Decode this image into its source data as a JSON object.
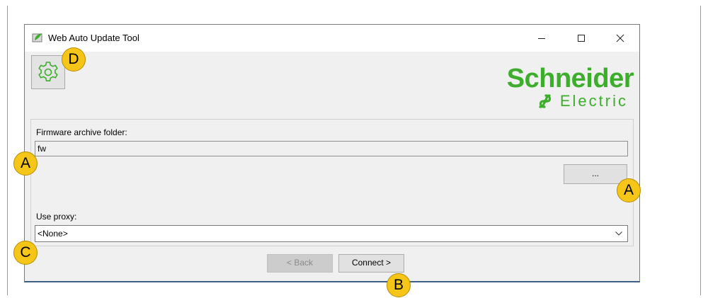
{
  "window": {
    "title": "Web Auto Update Tool",
    "minimize_icon": "minimize-icon",
    "maximize_icon": "maximize-icon",
    "close_icon": "close-icon"
  },
  "toolbar": {
    "settings_icon": "gear-icon"
  },
  "logo": {
    "line1": "Schneider",
    "line2": "Electric",
    "color": "#3dae2b"
  },
  "firmware": {
    "label": "Firmware archive folder:",
    "value": "fw",
    "browse_label": "..."
  },
  "proxy": {
    "label": "Use proxy:",
    "selected": "<None>"
  },
  "navigation": {
    "back_label": "< Back",
    "connect_label": "Connect >"
  },
  "markers": {
    "d": "D",
    "a1": "A",
    "a2": "A",
    "c": "C",
    "b": "B",
    "color": "#f5c518"
  }
}
